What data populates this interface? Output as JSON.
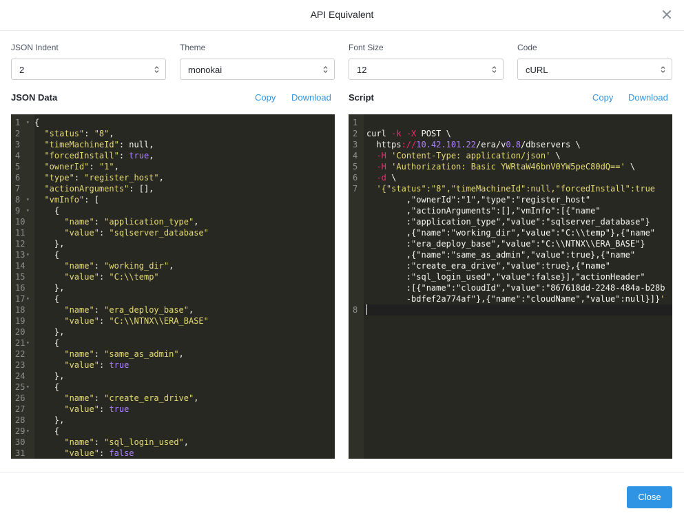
{
  "modal": {
    "title": "API Equivalent",
    "close_icon": "close-icon"
  },
  "controls": {
    "json_indent": {
      "label": "JSON Indent",
      "value": "2"
    },
    "theme": {
      "label": "Theme",
      "value": "monokai"
    },
    "font_size": {
      "label": "Font Size",
      "value": "12"
    },
    "code": {
      "label": "Code",
      "value": "cURL"
    }
  },
  "json_panel": {
    "label": "JSON Data",
    "copy": "Copy",
    "download": "Download",
    "lines": [
      {
        "n": "1",
        "fold": true,
        "code": "{"
      },
      {
        "n": "2",
        "code": "  \"status\": \"8\","
      },
      {
        "n": "3",
        "code": "  \"timeMachineId\": null,"
      },
      {
        "n": "4",
        "code": "  \"forcedInstall\": true,"
      },
      {
        "n": "5",
        "code": "  \"ownerId\": \"1\","
      },
      {
        "n": "6",
        "code": "  \"type\": \"register_host\","
      },
      {
        "n": "7",
        "code": "  \"actionArguments\": [],"
      },
      {
        "n": "8",
        "fold": true,
        "code": "  \"vmInfo\": ["
      },
      {
        "n": "9",
        "fold": true,
        "code": "    {"
      },
      {
        "n": "10",
        "code": "      \"name\": \"application_type\","
      },
      {
        "n": "11",
        "code": "      \"value\": \"sqlserver_database\""
      },
      {
        "n": "12",
        "code": "    },"
      },
      {
        "n": "13",
        "fold": true,
        "code": "    {"
      },
      {
        "n": "14",
        "code": "      \"name\": \"working_dir\","
      },
      {
        "n": "15",
        "code": "      \"value\": \"C:\\\\temp\""
      },
      {
        "n": "16",
        "code": "    },"
      },
      {
        "n": "17",
        "fold": true,
        "code": "    {"
      },
      {
        "n": "18",
        "code": "      \"name\": \"era_deploy_base\","
      },
      {
        "n": "19",
        "code": "      \"value\": \"C:\\\\NTNX\\\\ERA_BASE\""
      },
      {
        "n": "20",
        "code": "    },"
      },
      {
        "n": "21",
        "fold": true,
        "code": "    {"
      },
      {
        "n": "22",
        "code": "      \"name\": \"same_as_admin\","
      },
      {
        "n": "23",
        "code": "      \"value\": true"
      },
      {
        "n": "24",
        "code": "    },"
      },
      {
        "n": "25",
        "fold": true,
        "code": "    {"
      },
      {
        "n": "26",
        "code": "      \"name\": \"create_era_drive\","
      },
      {
        "n": "27",
        "code": "      \"value\": true"
      },
      {
        "n": "28",
        "code": "    },"
      },
      {
        "n": "29",
        "fold": true,
        "code": "    {"
      },
      {
        "n": "30",
        "code": "      \"name\": \"sql_login_used\","
      },
      {
        "n": "31",
        "code": "      \"value\": false"
      }
    ]
  },
  "script_panel": {
    "label": "Script",
    "copy": "Copy",
    "download": "Download",
    "lines": [
      {
        "n": "1",
        "code": ""
      },
      {
        "n": "2",
        "code": "curl -k -X POST \\"
      },
      {
        "n": "3",
        "code": "  https://10.42.101.22/era/v0.8/dbservers \\"
      },
      {
        "n": "4",
        "code": "  -H 'Content-Type: application/json' \\"
      },
      {
        "n": "5",
        "code": "  -H 'Authorization: Basic YWRtaW46bnV0YW5peC80dQ==' \\"
      },
      {
        "n": "6",
        "code": "  -d \\"
      },
      {
        "n": "7",
        "code": "  '{\"status\":\"8\",\"timeMachineId\":null,\"forcedInstall\":true"
      },
      {
        "n": "",
        "code": "        ,\"ownerId\":\"1\",\"type\":\"register_host\""
      },
      {
        "n": "",
        "code": "        ,\"actionArguments\":[],\"vmInfo\":[{\"name\""
      },
      {
        "n": "",
        "code": "        :\"application_type\",\"value\":\"sqlserver_database\"}"
      },
      {
        "n": "",
        "code": "        ,{\"name\":\"working_dir\",\"value\":\"C:\\\\temp\"},{\"name\""
      },
      {
        "n": "",
        "code": "        :\"era_deploy_base\",\"value\":\"C:\\\\NTNX\\\\ERA_BASE\"}"
      },
      {
        "n": "",
        "code": "        ,{\"name\":\"same_as_admin\",\"value\":true},{\"name\""
      },
      {
        "n": "",
        "code": "        :\"create_era_drive\",\"value\":true},{\"name\""
      },
      {
        "n": "",
        "code": "        :\"sql_login_used\",\"value\":false}],\"actionHeader\""
      },
      {
        "n": "",
        "code": "        :[{\"name\":\"cloudId\",\"value\":\"867618dd-2248-484a-b28b"
      },
      {
        "n": "",
        "code": "        -bdfef2a774af\"},{\"name\":\"cloudName\",\"value\":null}]}'"
      },
      {
        "n": "8",
        "code": "",
        "active": true
      }
    ]
  },
  "footer": {
    "close": "Close"
  }
}
